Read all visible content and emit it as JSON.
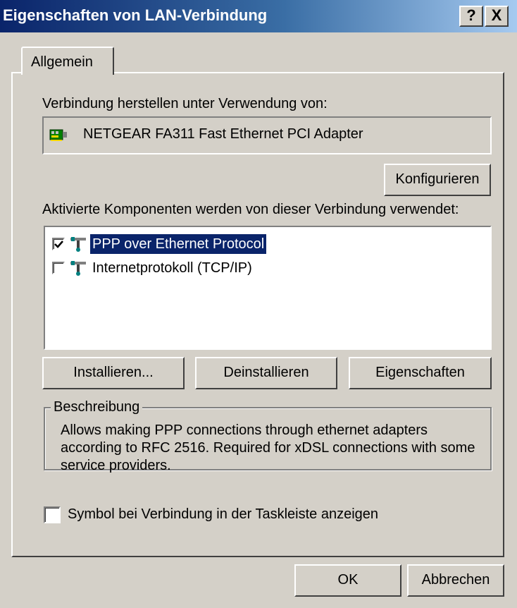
{
  "window": {
    "title": "Eigenschaften von LAN-Verbindung",
    "help_label": "?",
    "close_label": "X"
  },
  "tabs": [
    {
      "label": "Allgemein",
      "selected": true
    }
  ],
  "connection": {
    "label": "Verbindung herstellen unter Verwendung von:",
    "adapter_name": "NETGEAR FA311 Fast Ethernet PCI Adapter",
    "adapter_icon": "network-card-icon",
    "configure_label": "Konfigurieren"
  },
  "components": {
    "label": "Aktivierte Komponenten werden von dieser Verbindung verwendet:",
    "items": [
      {
        "label": "PPP over Ethernet Protocol",
        "checked": true,
        "selected": true,
        "icon": "protocol-icon"
      },
      {
        "label": "Internetprotokoll (TCP/IP)",
        "checked": false,
        "selected": false,
        "icon": "protocol-icon"
      }
    ]
  },
  "buttons": {
    "install": "Installieren...",
    "uninstall": "Deinstallieren",
    "properties": "Eigenschaften"
  },
  "description": {
    "legend": "Beschreibung",
    "text": "Allows making PPP connections through ethernet adapters according to RFC 2516. Required for xDSL connections with some service providers."
  },
  "taskbar_option": {
    "label": "Symbol bei Verbindung in der Taskleiste anzeigen",
    "checked": false
  },
  "footer": {
    "ok": "OK",
    "cancel": "Abbrechen"
  },
  "colors": {
    "title_bar_start": "#0a246a",
    "face": "#d4d0c8",
    "selection": "#0a246a"
  }
}
